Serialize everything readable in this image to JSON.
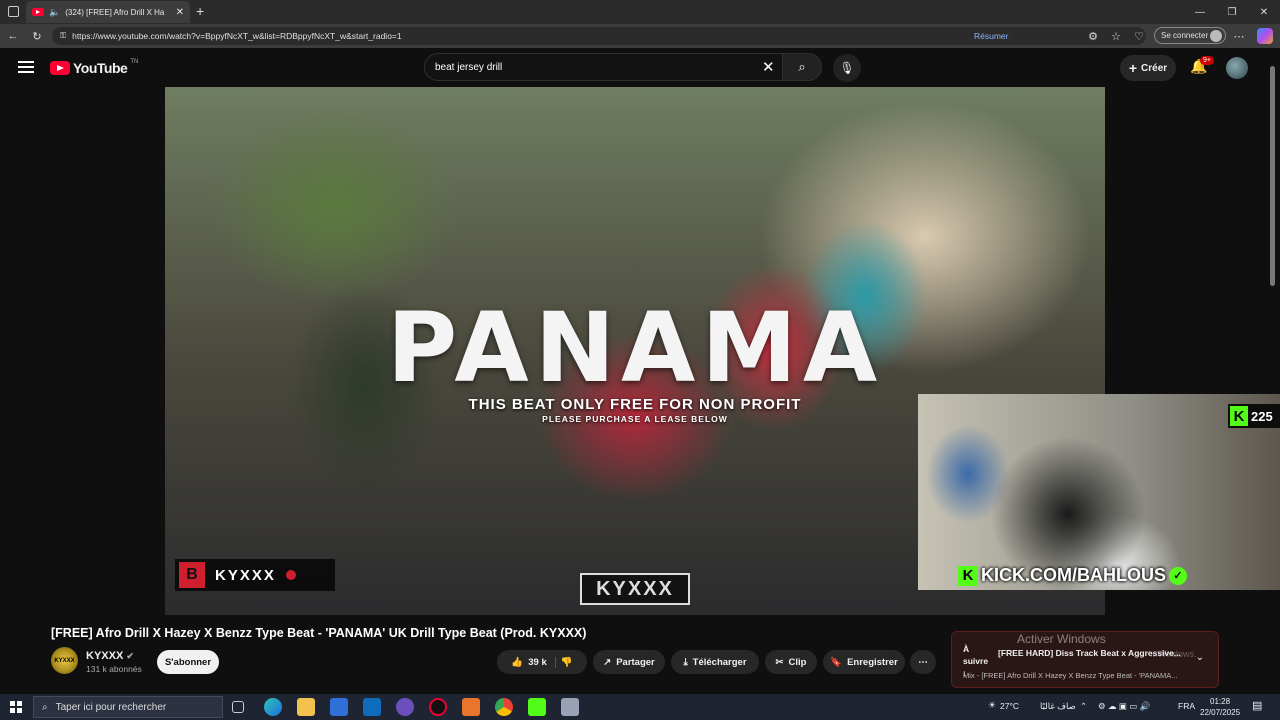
{
  "browser": {
    "tab_title": "(324) [FREE] Afro Drill X Ha...",
    "url": "https://www.youtube.com/watch?v=BppyfNcXT_w&list=RDBppyfNcXT_w&start_radio=1",
    "resume_label": "Résumer",
    "signin_label": "Se connecter"
  },
  "youtube": {
    "logo_text": "YouTube",
    "logo_region": "TN",
    "search_value": "beat jersey drill",
    "create_label": "Créer",
    "notifications_badge": "9+"
  },
  "video": {
    "overlay_title": "PANAMA",
    "overlay_sub1": "THIS BEAT ONLY FREE FOR NON PROFIT",
    "overlay_sub2": "PLEASE PURCHASE A LEASE BELOW",
    "watermark_left": "KYXXX",
    "watermark_center": "KYXXX",
    "title": "[FREE] Afro Drill X Hazey X Benzz Type Beat - 'PANAMA' UK Drill Type Beat (Prod. KYXXX)"
  },
  "stream_overlay": {
    "viewer_count": "225",
    "kick_url": "KICK.COM/BAHLOUS",
    "brand_color": "#53fc18"
  },
  "channel": {
    "avatar_text": "KYXXX",
    "name": "KYXXX",
    "subscribers": "131 k abonnés",
    "subscribe_label": "S'abonner"
  },
  "actions": {
    "likes": "39 k",
    "share": "Partager",
    "download": "Télécharger",
    "clip": "Clip",
    "save": "Enregistrer"
  },
  "up_next": {
    "label": "À suivre :",
    "title": "[FREE HARD] Diss Track Beat x Aggressive...",
    "mix": "Mix - [FREE] Afro Drill X Hazey X Benzz Type Beat - 'PANAMA..."
  },
  "watermark": {
    "line1": "Activer Windows",
    "line2": "...Windows."
  },
  "taskbar": {
    "search_placeholder": "Taper ici pour rechercher",
    "weather": "27°C",
    "weather_desc": "صاف غالبًا",
    "lang": "FRA",
    "time": "01:28",
    "date": "22/07/2025"
  }
}
